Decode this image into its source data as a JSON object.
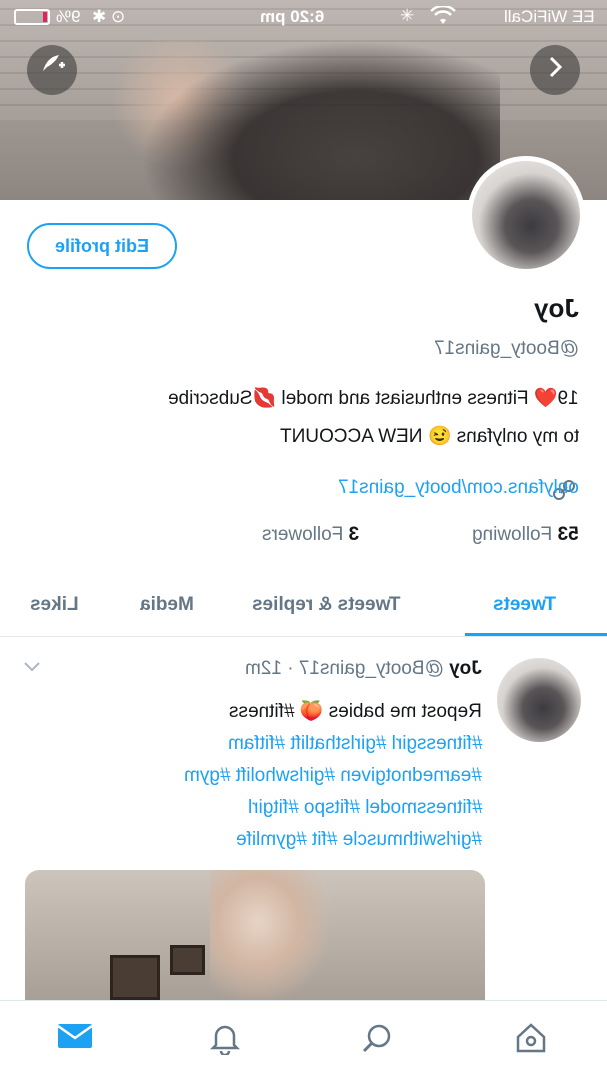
{
  "status_bar": {
    "carrier": "EE WiFiCall",
    "time": "6:20 pm",
    "battery_percent": "9%",
    "battery_level": 0.09
  },
  "banner": {
    "compose_icon": "compose-plus-icon",
    "next_icon": "chevron-right-icon"
  },
  "profile": {
    "edit_button": "Edit profile",
    "name": "Joy",
    "handle": "@Booty_gains17",
    "bio_line1": "19❤️ Fitness enthusiast and model 💋Subscribe",
    "bio_line2": "to my onlyfans 😉 NEW ACCOUNT",
    "link": "onlyfans.com/booty_gains17",
    "following_count": "53",
    "following_label": "Following",
    "followers_count": "3",
    "followers_label": "Followers"
  },
  "tabs": [
    {
      "label": "Tweets",
      "active": true
    },
    {
      "label": "Tweets & replies",
      "active": false
    },
    {
      "label": "Media",
      "active": false
    },
    {
      "label": "Likes",
      "active": false
    }
  ],
  "tweet": {
    "name": "Joy",
    "meta": "@Booty_gains17 · 12m",
    "text_line1": "Repost me babies 🍑 #fitness",
    "text_line2": "#fitnessgirl #girlsthatlift #fitfam",
    "text_line3": "#earnednotgiven #girlswholift #gym",
    "text_line4": "#fitnessmodel #fitspo #fitgirl",
    "text_line5": "#girlswithmuscle #fit #gymlife"
  },
  "colors": {
    "accent": "#1da1f2",
    "muted": "#657786",
    "text": "#14171a"
  },
  "bottom_nav": {
    "home_icon": "home-icon",
    "search_icon": "search-icon",
    "notifications_icon": "bell-icon",
    "messages_icon": "mail-icon"
  }
}
